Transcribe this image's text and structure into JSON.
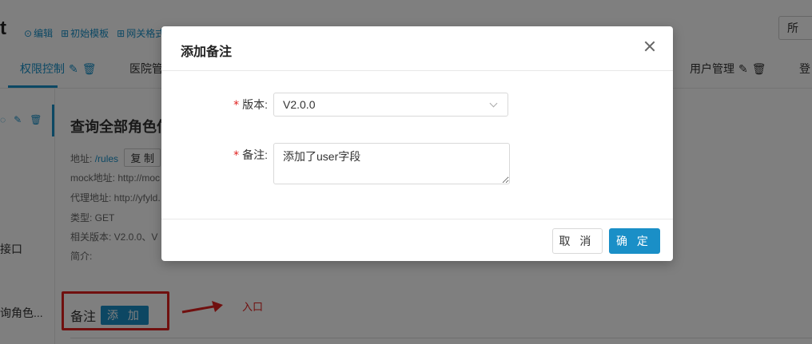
{
  "page": {
    "title_fragment": "t",
    "top_links": [
      {
        "icon": "edit-circle-icon",
        "label": "编辑"
      },
      {
        "icon": "grid-icon",
        "label": "初始模板"
      },
      {
        "icon": "grid-icon",
        "label": "网关格式"
      }
    ],
    "top_right_label": "所",
    "tabs": [
      {
        "label": "权限控制",
        "active": true
      },
      {
        "label": "医院管",
        "active": false
      },
      {
        "label": "用户管理",
        "active": false
      },
      {
        "label": "登",
        "active": false
      }
    ],
    "sidebar": {
      "items": [
        "接口",
        "询角色..."
      ]
    },
    "detail": {
      "title": "查询全部角色信",
      "address_label": "地址:",
      "address_value": "/rules",
      "copy_label": "复 制",
      "mock_line": "mock地址: http://moc",
      "proxy_line": "代理地址: http://yfyld.",
      "type_line": "类型: GET",
      "versions_line": "相关版本: V2.0.0、V",
      "intro_line": "简介:"
    },
    "notes": {
      "label": "备注",
      "add_label": "添 加"
    },
    "annotation": {
      "entry_label": "入口"
    }
  },
  "modal": {
    "title": "添加备注",
    "version_label": "版本:",
    "version_value": "V2.0.0",
    "note_label": "备注:",
    "note_value": "添加了user字段",
    "required_mark": "*",
    "cancel_label": "取 消",
    "ok_label": "确 定"
  },
  "colors": {
    "accent": "#1a8fc7",
    "required": "#e0201e",
    "annotation": "#e0201e"
  }
}
